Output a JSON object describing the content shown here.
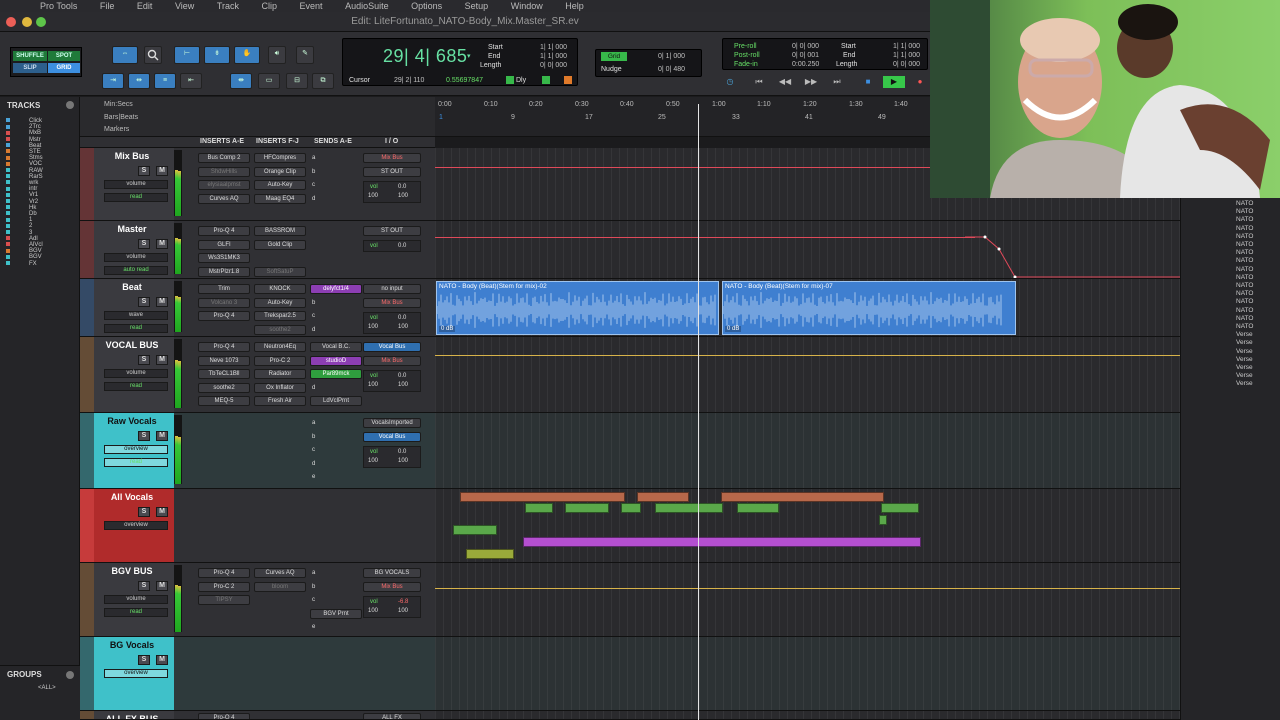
{
  "menubar": [
    "Pro Tools",
    "File",
    "Edit",
    "View",
    "Track",
    "Clip",
    "Event",
    "AudioSuite",
    "Options",
    "Setup",
    "Window",
    "Help"
  ],
  "window": {
    "title": "Edit: LiteFortunato_NATO-Body_Mix.Master_SR.ev"
  },
  "toolbar": {
    "modes": [
      "SHUFFLE",
      "SPOT",
      "SLIP",
      "GRID"
    ],
    "main_counter": "29| 4| 685",
    "start_label": "Start",
    "end_label": "End",
    "length_label": "Length",
    "start_val": "1| 1| 000",
    "end_val": "1| 1| 000",
    "length_val": "0| 0| 000",
    "cursor_label": "Cursor",
    "cursor_val": "29| 2| 110",
    "cursor_extra": "0.55697847",
    "dly_label": "Dly",
    "grid_label": "Grid",
    "grid_val": "0| 1| 000",
    "nudge_label": "Nudge",
    "nudge_val": "0| 0| 480",
    "preroll_label": "Pre-roll",
    "postroll_label": "Post-roll",
    "fadein_label": "Fade-in",
    "preroll_val": "0| 0| 000",
    "postroll_val": "0| 0| 001",
    "fadein_val": "0:00.250",
    "start2_label": "Start",
    "end2_label": "End",
    "length2_label": "Length",
    "start2_val": "1| 1| 000",
    "end2_val": "1| 1| 000",
    "length2_val": "0| 0| 000"
  },
  "tracks_panel": {
    "title": "TRACKS",
    "items": [
      {
        "name": "Click",
        "color": "#4aa3d8"
      },
      {
        "name": "2Trc",
        "color": "#4aa3d8"
      },
      {
        "name": "MxB",
        "color": "#d94f4f"
      },
      {
        "name": "Mstr",
        "color": "#d94f4f"
      },
      {
        "name": "Beat",
        "color": "#4aa3d8"
      },
      {
        "name": "STE",
        "color": "#d97a30"
      },
      {
        "name": "Stms",
        "color": "#d97a30"
      },
      {
        "name": "VOC",
        "color": "#d97a30"
      },
      {
        "name": "RAW",
        "color": "#3fc1c9"
      },
      {
        "name": "RarS",
        "color": "#3fc1c9"
      },
      {
        "name": "wrk",
        "color": "#3fc1c9"
      },
      {
        "name": "intr",
        "color": "#3fc1c9"
      },
      {
        "name": "Vr1",
        "color": "#3fc1c9"
      },
      {
        "name": "Vr2",
        "color": "#3fc1c9"
      },
      {
        "name": "Hk",
        "color": "#3fc1c9"
      },
      {
        "name": "Db",
        "color": "#3fc1c9"
      },
      {
        "name": "1",
        "color": "#3fc1c9"
      },
      {
        "name": "2",
        "color": "#3fc1c9"
      },
      {
        "name": "3",
        "color": "#3fc1c9"
      },
      {
        "name": "Adl",
        "color": "#d94f4f"
      },
      {
        "name": "AlVcl",
        "color": "#d94f4f"
      },
      {
        "name": "BGV",
        "color": "#d97a30"
      },
      {
        "name": "BGV",
        "color": "#3fc1c9"
      },
      {
        "name": "FX",
        "color": "#3fc1c9"
      }
    ],
    "groups_title": "GROUPS",
    "groups_all": "<ALL>"
  },
  "rulers": {
    "minsec": "Min:Secs",
    "bars": "Bars|Beats",
    "markers": "Markers",
    "time_ticks": [
      "0:00",
      "0:10",
      "0:20",
      "0:30",
      "0:40",
      "0:50",
      "1:00",
      "1:10",
      "1:20",
      "1:30",
      "1:40"
    ],
    "bar_ticks": [
      "1",
      "9",
      "17",
      "25",
      "33",
      "41",
      "49"
    ]
  },
  "columns": {
    "inserts_ae": "INSERTS A-E",
    "inserts_fj": "INSERTS F-J",
    "sends_ae": "SENDS A-E",
    "io": "I / O"
  },
  "tracks": [
    {
      "name": "Mix Bus",
      "color": "#c63b3b",
      "select": "volume",
      "mode": "read",
      "inserts_a": [
        "Bus Comp 2",
        "ShdwHills",
        "elysiaalpmst",
        "Curves AQ"
      ],
      "inserts_f": [
        "HFCompres",
        "Orange Clip",
        "Auto-Key",
        "Maag EQ4"
      ],
      "sends": [
        "a",
        "b",
        "c",
        "d"
      ],
      "io": [
        "Mix Bus",
        "ST OUT"
      ],
      "vol": "0.0",
      "pan_l": "100",
      "pan_r": "100"
    },
    {
      "name": "Master",
      "color": "#c63b3b",
      "select": "volume",
      "mode": "auto read",
      "inserts_a": [
        "Pro-Q 4",
        "GLFI",
        "Ws3S1MK3",
        "MstrPlzr1.8"
      ],
      "inserts_f": [
        "BASSROM",
        "Gold Clip",
        "",
        "SoftSatuP"
      ],
      "sends": [],
      "io": [
        "ST OUT"
      ],
      "vol": "0.0"
    },
    {
      "name": "Beat",
      "color": "#3b7bc6",
      "select": "wave",
      "mode": "read",
      "inserts_a": [
        "Trim",
        "Volcano 3",
        "Pro-Q 4"
      ],
      "inserts_f": [
        "KNOCK",
        "Auto-Key",
        "Trekspar2.5",
        "soothe2"
      ],
      "sends": [
        "delyfct1/4",
        "b",
        "c",
        "d"
      ],
      "io": [
        "no input",
        "Mix Bus"
      ],
      "vol": "0.0",
      "pan_l": "100",
      "pan_r": "100",
      "clips": [
        "NATO - Body (Beat)(Stem for mix)-02",
        "NATO - Body (Beat)(Stem for mix)-07"
      ],
      "clip_db": "0 dB"
    },
    {
      "name": "VOCAL BUS",
      "color": "#c6803b",
      "select": "volume",
      "mode": "read",
      "inserts_a": [
        "Pro-Q 4",
        "Neve 1073",
        "TbTeCL1Bll",
        "soothe2",
        "MEQ-5"
      ],
      "inserts_f": [
        "Neutron4Eq",
        "Pro-C 2",
        "Radiator",
        "Ox Inflator",
        "Fresh Air"
      ],
      "sends": [
        "Vocal B.C.",
        "studioD",
        "Par89mck",
        "d",
        "LdVclPrnt"
      ],
      "io": [
        "Vocal Bus",
        "Mix Bus"
      ],
      "vol": "0.0",
      "pan_l": "100",
      "pan_r": "100"
    },
    {
      "name": "Raw Vocals",
      "color": "#3fc1c9",
      "select": "overview",
      "mode": "read",
      "sends": [
        "a",
        "b",
        "c",
        "d",
        "e"
      ],
      "io": [
        "VocalsImported",
        "Vocal Bus"
      ],
      "vol": "0.0",
      "pan_l": "100",
      "pan_r": "100"
    },
    {
      "name": "All Vocals",
      "color": "#c63b3b",
      "select": "overview"
    },
    {
      "name": "BGV BUS",
      "color": "#c6803b",
      "select": "volume",
      "mode": "read",
      "inserts_a": [
        "Pro-Q 4",
        "Pro-C 2",
        "TIPSY"
      ],
      "inserts_f": [
        "Curves AQ",
        "bloom"
      ],
      "sends": [
        "a",
        "b",
        "c",
        "BGV Prnt",
        "e"
      ],
      "io": [
        "BG VOCALS",
        "Mix Bus"
      ],
      "vol": "-6.8",
      "pan_l": "100",
      "pan_r": "100"
    },
    {
      "name": "BG Vocals",
      "color": "#3fc1c9",
      "select": "overview"
    },
    {
      "name": "ALL FX BUS",
      "color": "#c6803b",
      "insert": "Pro-Q 4",
      "io": "ALL FX"
    }
  ],
  "verse_labels": [
    "NATO",
    "NATO",
    "NATO",
    "NATO",
    "NATO",
    "NATO",
    "NATO",
    "NATO",
    "NATO",
    "NATO",
    "NATO",
    "NATO",
    "NATO",
    "NATO",
    "NATO",
    "NATO",
    "Verse",
    "Verse",
    "Verse",
    "Verse",
    "Verse",
    "Verse",
    "Verse"
  ],
  "colors": {
    "counter": "#67e0a3",
    "clip": "#3f7fd0",
    "auto_red": "#e04a5a",
    "auto_gold": "#d8b34a",
    "midi_brown": "#b7684a",
    "midi_green": "#5aa84a",
    "midi_purple": "#b44fd0",
    "midi_olive": "#9aaa3a"
  }
}
